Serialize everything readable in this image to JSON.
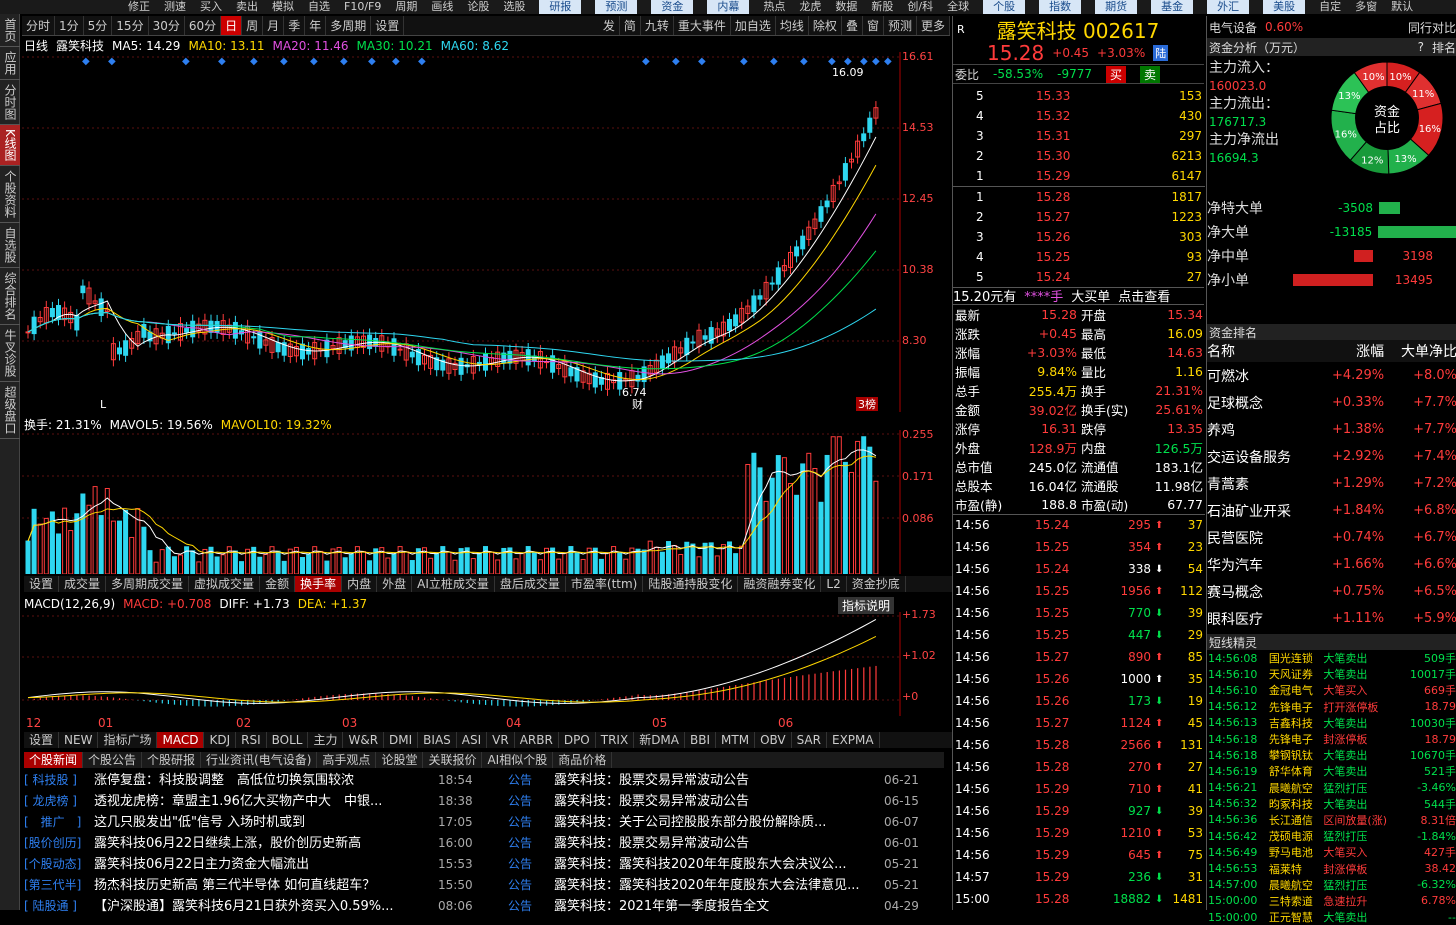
{
  "topbar": [
    "修正",
    "测速",
    "买入",
    "卖出",
    "模拟",
    "自选",
    "F10/F9",
    "周期",
    "画线",
    "论股",
    "选股",
    "研报",
    "预测",
    "资金",
    "内幕",
    "热点",
    "龙虎",
    "数据",
    "新股",
    "创/科",
    "全球",
    "个股",
    "指数",
    "期货",
    "基金",
    "外汇",
    "美股",
    "自定",
    "多窗",
    "默认"
  ],
  "sidebar": [
    "首页",
    "应用",
    "分时图",
    "K线图",
    "个股资料",
    "自选股",
    "综合排名",
    "牛叉诊股",
    "超级盘口"
  ],
  "periods": [
    "分时",
    "1分",
    "5分",
    "15分",
    "30分",
    "60分",
    "日",
    "周",
    "月",
    "季",
    "年",
    "多周期",
    "设置"
  ],
  "tools": [
    "发",
    "简",
    "九转",
    "重大事件",
    "加自选",
    "均线",
    "除权",
    "叠",
    "窗",
    "预测",
    "更多"
  ],
  "kline": {
    "label": "日线",
    "name": "露笑科技",
    "ma5": "MA5: 14.29",
    "ma10": "MA10: 13.11",
    "ma20": "MA20: 11.46",
    "ma30": "MA30: 10.21",
    "ma60": "MA60: 8.62",
    "high_mark": "16.09",
    "low_mark": "6.74",
    "cai": "财",
    "bang": "3榜",
    "L": "L",
    "yaxis": [
      "16.61",
      "14.53",
      "12.45",
      "10.38",
      "8.30"
    ]
  },
  "vol": {
    "hs": "换手: 21.31%",
    "m5": "MAVOL5: 19.56%",
    "m10": "MAVOL10: 19.32%",
    "yaxis": [
      "0.255",
      "0.171",
      "0.086"
    ]
  },
  "voltabs": [
    "设置",
    "成交量",
    "多周期成交量",
    "虚拟成交量",
    "金额",
    "换手率",
    "内盘",
    "外盘",
    "AI立桩成交量",
    "盘后成交量",
    "市盈率(ttm)",
    "陆股通持股变化",
    "融资融券变化",
    "L2",
    "资金抄底"
  ],
  "macd": {
    "name": "MACD(12,26,9)",
    "macd": "MACD: +0.708",
    "diff": "DIFF: +1.73",
    "dea": "DEA: +1.37",
    "btn": "指标说明",
    "yaxis": [
      "+1.73",
      "+1.02",
      "+0"
    ],
    "months": [
      "12",
      "01",
      "02",
      "03",
      "04",
      "05",
      "06"
    ]
  },
  "indtabs": [
    "设置",
    "NEW",
    "指标广场",
    "MACD",
    "KDJ",
    "RSI",
    "BOLL",
    "主力",
    "W&R",
    "DMI",
    "BIAS",
    "ASI",
    "VR",
    "ARBR",
    "DPO",
    "TRIX",
    "新DMA",
    "BBI",
    "MTM",
    "OBV",
    "SAR",
    "EXPMA"
  ],
  "newstabs": [
    "个股新闻",
    "个股公告",
    "个股研报",
    "行业资讯(电气设备)",
    "高手观点",
    "论股堂",
    "关联报价",
    "AI相似个股",
    "商品价格"
  ],
  "news_left": [
    [
      "[ 科技股 ]",
      "涨停复盘：科技股调整　高低位切换氛围较浓",
      "18:54"
    ],
    [
      "[ 龙虎榜 ]",
      "透视龙虎榜：章盟主1.96亿大买物产中大　中银...",
      "18:38"
    ],
    [
      "[　推广　]",
      "这几只股发出\"低\"信号 入场时机或到",
      "17:05"
    ],
    [
      "[股价创历]",
      "露笑科技06月22日继续上涨，股价创历史新高",
      "16:00"
    ],
    [
      "[个股动态]",
      "露笑科技06月22日主力资金大幅流出",
      "15:53"
    ],
    [
      "[第三代半]",
      "扬杰科技历史新高 第三代半导体 如何直线超车？",
      "15:50"
    ],
    [
      "[ 陆股通 ]",
      "【沪深股通】露笑科技6月21日获外资买入0.59%...",
      "08:06"
    ]
  ],
  "news_right": [
    [
      "公告",
      "露笑科技：股票交易异常波动公告",
      "06-21"
    ],
    [
      "公告",
      "露笑科技：股票交易异常波动公告",
      "06-15"
    ],
    [
      "公告",
      "露笑科技：关于公司控股股东部分股份解除质...",
      "06-07"
    ],
    [
      "公告",
      "露笑科技：股票交易异常波动公告",
      "06-01"
    ],
    [
      "公告",
      "露笑科技：露笑科技2020年年度股东大会决议公...",
      "05-21"
    ],
    [
      "公告",
      "露笑科技：露笑科技2020年年度股东大会法律意见...",
      "05-21"
    ],
    [
      "公告",
      "露笑科技：2021年第一季度报告全文",
      "04-29"
    ]
  ],
  "quote": {
    "title": "露笑科技 002617",
    "price": "15.28",
    "chg": "+0.45",
    "pct": "+3.03%",
    "lu": "陆",
    "webi": "委比",
    "webi_pct": "-58.53%",
    "webi_val": "-9777",
    "buy": "买",
    "sell": "卖"
  },
  "sells": [
    [
      "5",
      "15.33",
      "153"
    ],
    [
      "4",
      "15.32",
      "430"
    ],
    [
      "3",
      "15.31",
      "297"
    ],
    [
      "2",
      "15.30",
      "6213"
    ],
    [
      "1",
      "15.29",
      "6147"
    ]
  ],
  "buys": [
    [
      "1",
      "15.28",
      "1817"
    ],
    [
      "2",
      "15.27",
      "1223"
    ],
    [
      "3",
      "15.26",
      "303"
    ],
    [
      "4",
      "15.25",
      "93"
    ],
    [
      "5",
      "15.24",
      "27"
    ]
  ],
  "bigorder": [
    "15.20元有",
    "****手",
    "大买单",
    "点击查看"
  ],
  "stats": [
    [
      "最新",
      "15.28",
      "开盘",
      "15.34"
    ],
    [
      "涨跌",
      "+0.45",
      "最高",
      "16.09"
    ],
    [
      "涨幅",
      "+3.03%",
      "最低",
      "14.63"
    ],
    [
      "振幅",
      "9.84%",
      "量比",
      "1.16"
    ],
    [
      "总手",
      "255.4万",
      "换手",
      "21.31%"
    ],
    [
      "金额",
      "39.02亿",
      "换手(实)",
      "25.61%"
    ],
    [
      "涨停",
      "16.31",
      "跌停",
      "13.35"
    ],
    [
      "外盘",
      "128.9万",
      "内盘",
      "126.5万"
    ],
    [
      "总市值",
      "245.0亿",
      "流通值",
      "183.1亿"
    ],
    [
      "总股本",
      "16.04亿",
      "流通股",
      "11.98亿"
    ],
    [
      "市盈(静)",
      "188.8",
      "市盈(动)",
      "67.77"
    ]
  ],
  "ticks": [
    [
      "14:56",
      "15.24",
      "295",
      "37"
    ],
    [
      "14:56",
      "15.25",
      "354",
      "23"
    ],
    [
      "14:56",
      "15.24",
      "338",
      "54"
    ],
    [
      "14:56",
      "15.25",
      "1956",
      "112"
    ],
    [
      "14:56",
      "15.25",
      "770",
      "39"
    ],
    [
      "14:56",
      "15.25",
      "447",
      "29"
    ],
    [
      "14:56",
      "15.27",
      "890",
      "85"
    ],
    [
      "14:56",
      "15.26",
      "1000",
      "35"
    ],
    [
      "14:56",
      "15.26",
      "173",
      "19"
    ],
    [
      "14:56",
      "15.27",
      "1124",
      "45"
    ],
    [
      "14:56",
      "15.28",
      "2566",
      "131"
    ],
    [
      "14:56",
      "15.28",
      "270",
      "27"
    ],
    [
      "14:56",
      "15.29",
      "710",
      "41"
    ],
    [
      "14:56",
      "15.29",
      "927",
      "39"
    ],
    [
      "14:56",
      "15.29",
      "1210",
      "53"
    ],
    [
      "14:56",
      "15.29",
      "645",
      "75"
    ],
    [
      "14:57",
      "15.29",
      "236",
      "31"
    ],
    [
      "15:00",
      "15.28",
      "18882",
      "1481"
    ]
  ],
  "sector": {
    "name": "电气设备",
    "pct": "0.60%",
    "peer": "同行对比"
  },
  "fund": {
    "title": "资金分析（万元）",
    "help": "?",
    "rank": "排名",
    "in_label": "主力流入：",
    "in": "160023.0",
    "out_label": "主力流出：",
    "out": "176717.3",
    "net_label": "主力净流出",
    "net": "16694.3",
    "pie": [
      "10%",
      "11%",
      "16%",
      "13%",
      "12%",
      "16%",
      "13%",
      "10%"
    ],
    "center1": "资金",
    "center2": "占比"
  },
  "nets": [
    [
      "净特大单",
      "-3508"
    ],
    [
      "净大单",
      "-13185"
    ],
    [
      "净中单",
      "3198"
    ],
    [
      "净小单",
      "13495"
    ]
  ],
  "rank": {
    "title": "资金排名",
    "cols": [
      "名称",
      "涨幅",
      "大单净比"
    ],
    "rows": [
      [
        "可燃冰",
        "+4.29%",
        "+8.0%"
      ],
      [
        "足球概念",
        "+0.33%",
        "+7.7%"
      ],
      [
        "养鸡",
        "+1.38%",
        "+7.7%"
      ],
      [
        "交运设备服务",
        "+2.92%",
        "+7.4%"
      ],
      [
        "青蒿素",
        "+1.29%",
        "+7.2%"
      ],
      [
        "石油矿业开采",
        "+1.84%",
        "+6.8%"
      ],
      [
        "民营医院",
        "+0.74%",
        "+6.7%"
      ],
      [
        "华为汽车",
        "+1.66%",
        "+6.6%"
      ],
      [
        "赛马概念",
        "+0.75%",
        "+6.5%"
      ],
      [
        "眼科医疗",
        "+1.11%",
        "+5.9%"
      ]
    ]
  },
  "short": {
    "title": "短线精灵",
    "rows": [
      [
        "14:56:08",
        "国光连锁",
        "大笔卖出",
        "509手"
      ],
      [
        "14:56:10",
        "天风证券",
        "大笔卖出",
        "10017手"
      ],
      [
        "14:56:10",
        "金冠电气",
        "大笔买入",
        "669手"
      ],
      [
        "14:56:12",
        "先锋电子",
        "打开涨停板",
        "18.79"
      ],
      [
        "14:56:13",
        "吉鑫科技",
        "大笔卖出",
        "10030手"
      ],
      [
        "14:56:18",
        "先锋电子",
        "封涨停板",
        "18.79"
      ],
      [
        "14:56:18",
        "攀钢钒钛",
        "大笔卖出",
        "10670手"
      ],
      [
        "14:56:19",
        "舒华体育",
        "大笔卖出",
        "521手"
      ],
      [
        "14:56:21",
        "晨曦航空",
        "猛烈打压",
        "-3.46%"
      ],
      [
        "14:56:32",
        "昀冢科技",
        "大笔卖出",
        "544手"
      ],
      [
        "14:56:36",
        "长江通信",
        "区间放量(涨)",
        "8.31倍"
      ],
      [
        "14:56:42",
        "茂硕电源",
        "猛烈打压",
        "-1.84%"
      ],
      [
        "14:56:49",
        "野马电池",
        "大笔买入",
        "427手"
      ],
      [
        "14:56:53",
        "福莱特",
        "封涨停板",
        "38.42"
      ],
      [
        "14:57:00",
        "晨曦航空",
        "猛烈打压",
        "-6.32%"
      ],
      [
        "15:00:00",
        "三特索道",
        "急速拉升",
        "6.78%"
      ],
      [
        "15:00:00",
        "正元智慧",
        "大笔卖出",
        "--"
      ]
    ]
  }
}
